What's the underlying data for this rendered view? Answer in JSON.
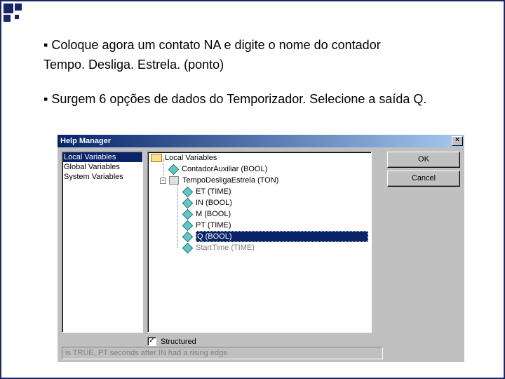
{
  "bullets": {
    "b1_line1": "Coloque agora um contato NA e digite o nome do contador",
    "b1_line2": "Tempo. Desliga. Estrela. (ponto)",
    "b2": "Surgem  6 opções de dados do Temporizador. Selecione a saída Q."
  },
  "dialog": {
    "title": "Help Manager",
    "buttons": {
      "ok": "OK",
      "cancel": "Cancel"
    },
    "left": {
      "i0": "Local Variables",
      "i1": "Global Variables",
      "i2": "System Variables"
    },
    "tree": {
      "root": "Local Variables",
      "n1": "ContadorAuxiliar (BOOL)",
      "n2": "TempoDesligaEstrela (TON)",
      "c0": "ET (TIME)",
      "c1": "IN (BOOL)",
      "c2": "M (BOOL)",
      "c3": "PT (TIME)",
      "c4": "Q (BOOL)",
      "c5": "StartTime (TIME)"
    },
    "checkbox_label": "Structured",
    "status": "is TRUE, PT seconds after IN had a rising edge"
  }
}
